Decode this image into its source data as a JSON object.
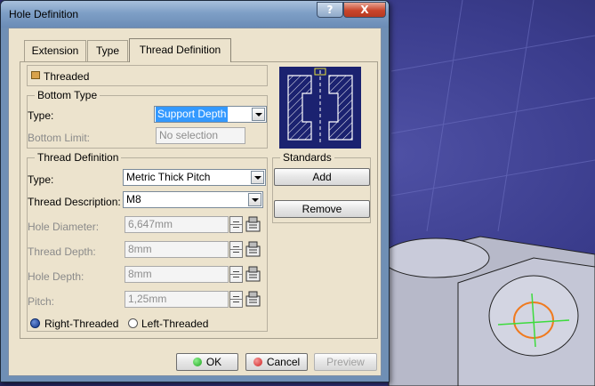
{
  "window": {
    "title": "Hole Definition",
    "help_label": "?",
    "close_label": "X"
  },
  "tabs": [
    {
      "label": "Extension",
      "selected": false
    },
    {
      "label": "Type",
      "selected": false
    },
    {
      "label": "Thread Definition",
      "selected": true
    }
  ],
  "threaded": {
    "label": "Threaded",
    "checked": true
  },
  "bottom_type": {
    "legend": "Bottom Type",
    "type_label": "Type:",
    "type_value": "Support Depth",
    "limit_label": "Bottom Limit:",
    "limit_value": "No selection"
  },
  "thread_definition": {
    "legend": "Thread Definition",
    "type_label": "Type:",
    "type_value": "Metric Thick Pitch",
    "description_label": "Thread Description:",
    "description_value": "M8",
    "hole_diameter_label": "Hole Diameter:",
    "hole_diameter_value": "6,647mm",
    "thread_depth_label": "Thread Depth:",
    "thread_depth_value": "8mm",
    "hole_depth_label": "Hole Depth:",
    "hole_depth_value": "8mm",
    "pitch_label": "Pitch:",
    "pitch_value": "1,25mm",
    "right_label": "Right-Threaded",
    "left_label": "Left-Threaded",
    "handedness": "right"
  },
  "standards": {
    "legend": "Standards",
    "add_label": "Add",
    "remove_label": "Remove"
  },
  "footer": {
    "ok_label": "OK",
    "cancel_label": "Cancel",
    "preview_label": "Preview"
  },
  "colors": {
    "ok_icon": "#1fa51f",
    "cancel_icon": "#d02020",
    "selection": "#3399ff"
  }
}
